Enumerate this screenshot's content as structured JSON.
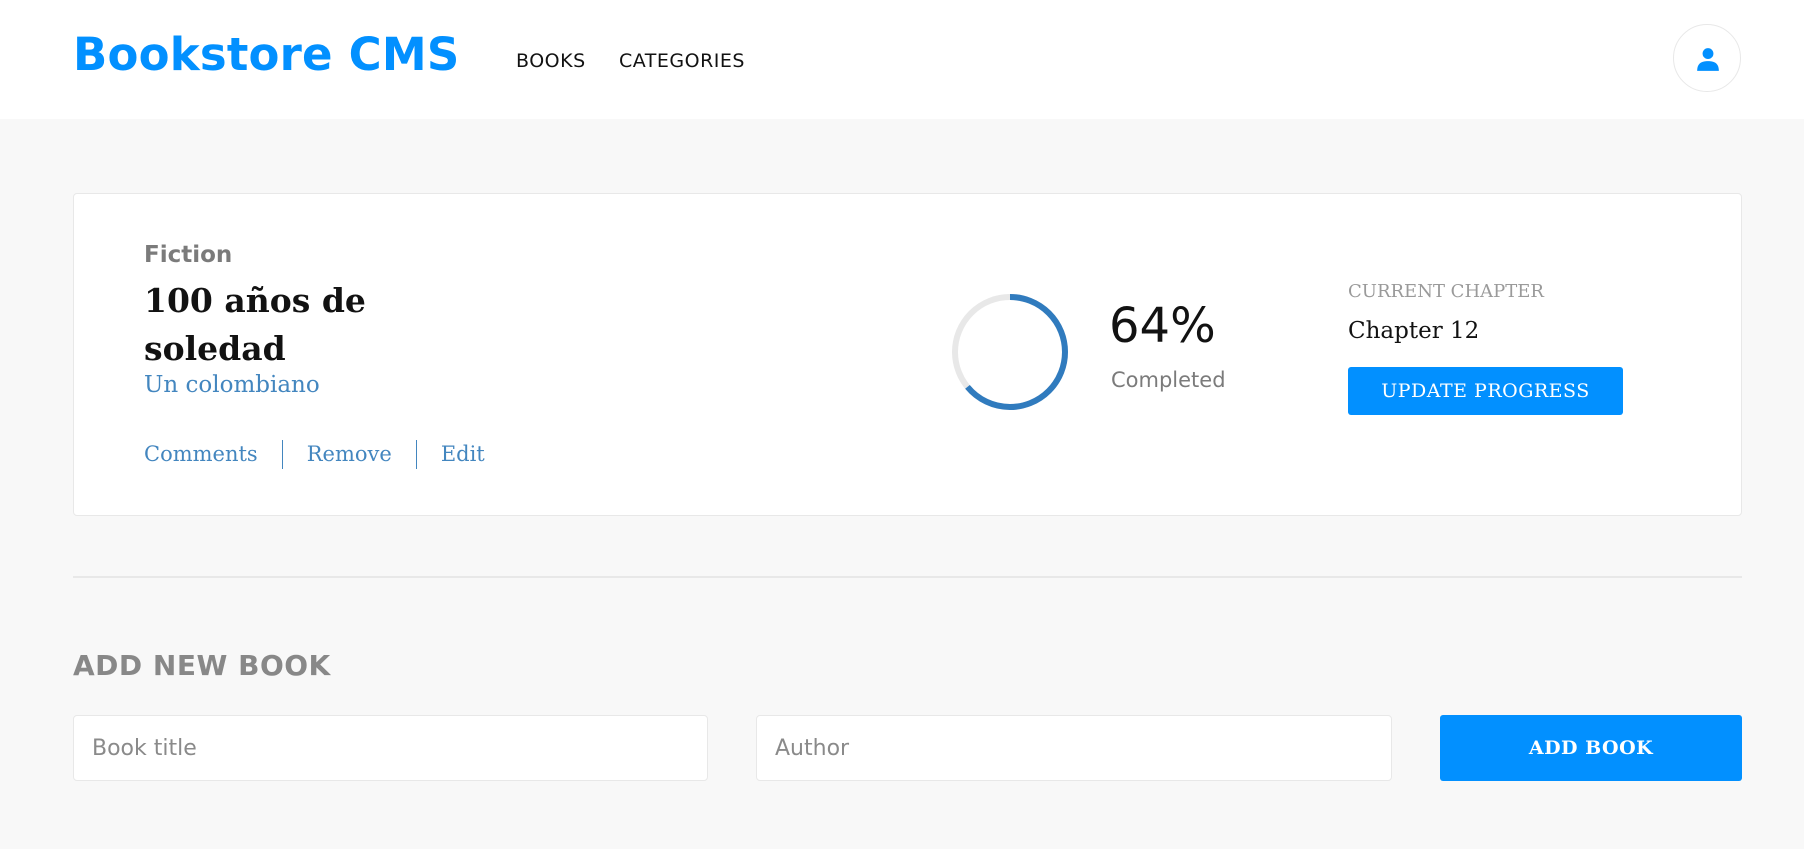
{
  "header": {
    "logo": "Bookstore CMS",
    "nav": [
      {
        "label": "BOOKS"
      },
      {
        "label": "CATEGORIES"
      }
    ],
    "user_icon": "user-icon"
  },
  "colors": {
    "accent": "#0290ff",
    "link": "#4386bf",
    "progress": "#307bbe",
    "progress_track": "#e8e8e8",
    "background": "#f8f8f8"
  },
  "books": [
    {
      "genre": "Fiction",
      "title": "100 años de soledad",
      "author": "Un colombiano",
      "actions": {
        "comments": "Comments",
        "remove": "Remove",
        "edit": "Edit"
      },
      "progress": {
        "percent": 64,
        "percent_label": "64%",
        "completed_label": "Completed"
      },
      "chapter": {
        "label": "CURRENT CHAPTER",
        "value": "Chapter 12",
        "update_label": "UPDATE PROGRESS"
      }
    }
  ],
  "form": {
    "title": "ADD NEW BOOK",
    "title_placeholder": "Book title",
    "author_placeholder": "Author",
    "submit_label": "ADD BOOK"
  }
}
